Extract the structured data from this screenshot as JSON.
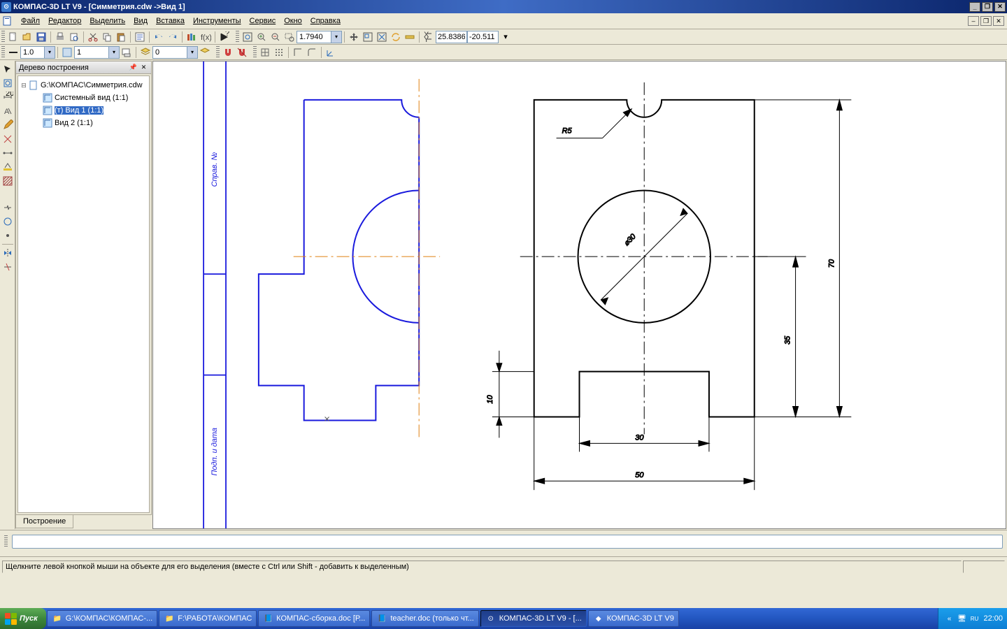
{
  "titlebar": {
    "title": "КОМПАС-3D LT V9 - [Симметрия.cdw ->Вид 1]"
  },
  "menu": {
    "file": "Файл",
    "edit": "Редактор",
    "select": "Выделить",
    "view": "Вид",
    "insert": "Вставка",
    "tools": "Инструменты",
    "service": "Сервис",
    "window": "Окно",
    "help": "Справка"
  },
  "toolbar1": {
    "zoom": "1.7940",
    "coord_x": "25.8386",
    "coord_y": "-20.511"
  },
  "toolbar2": {
    "scale": "1.0",
    "view_num": "1",
    "layer": "0"
  },
  "tree": {
    "title": "Дерево построения",
    "root": "G:\\КОМПАС\\Симметрия.cdw",
    "items": [
      "Системный вид (1:1)",
      "(т) Вид 1 (1:1)",
      "Вид 2 (1:1)"
    ],
    "tab": "Построение"
  },
  "drawing": {
    "left_labels": {
      "top": "Справ. №",
      "bottom": "Подп. и дата"
    },
    "dims": {
      "r5": "R5",
      "d30": "⌀30",
      "h70": "70",
      "h35": "35",
      "h10": "10",
      "w30": "30",
      "w50": "50"
    }
  },
  "status": {
    "msg": "Щелкните левой кнопкой мыши на объекте для его выделения (вместе с Ctrl или Shift - добавить к выделенным)"
  },
  "taskbar": {
    "start": "Пуск",
    "tasks": [
      "G:\\КОМПАС\\КОМПАС-...",
      "F:\\РАБОТА\\КОМПАС",
      "КОМПАС-сборка.doc [Р...",
      "teacher.doc (только чт...",
      "КОМПАС-3D LT V9 - [...",
      "КОМПАС-3D LT V9"
    ],
    "time": "22:00",
    "tray_expand": "«"
  }
}
